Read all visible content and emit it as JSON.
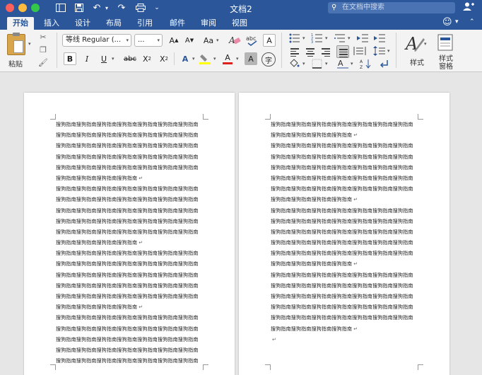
{
  "window": {
    "title": "文档2",
    "search_placeholder": "在文档中搜索"
  },
  "tabs": [
    {
      "label": "开始",
      "active": true
    },
    {
      "label": "插入"
    },
    {
      "label": "设计"
    },
    {
      "label": "布局"
    },
    {
      "label": "引用"
    },
    {
      "label": "邮件"
    },
    {
      "label": "审阅"
    },
    {
      "label": "视图"
    }
  ],
  "ribbon": {
    "paste_label": "粘贴",
    "font_name": "等线 Regular (...",
    "font_size": "...",
    "grow_font": "A",
    "shrink_font": "A",
    "change_case": "Aa",
    "clear_format": "A",
    "bold": "B",
    "italic": "I",
    "underline": "U",
    "strikethrough": "abc",
    "subscript": "X",
    "superscript": "X",
    "sub_digit": "2",
    "text_effects": "A",
    "font_color": "A",
    "char_shading": "A",
    "phonetic": "字",
    "styles_label": "样式",
    "styles_pane_label": "样式\n窗格"
  },
  "document": {
    "paragraph_mark": "↵",
    "text_line": "搜狗指南搜狗指南搜狗指南搜狗指南搜狗指南搜狗指南搜狗指南",
    "last_line": "搜狗指南搜狗指南搜狗指南搜狗指南"
  },
  "colors": {
    "brand_blue": "#2b579a",
    "highlight_yellow": "#ffff00",
    "font_red": "#e0201c"
  }
}
